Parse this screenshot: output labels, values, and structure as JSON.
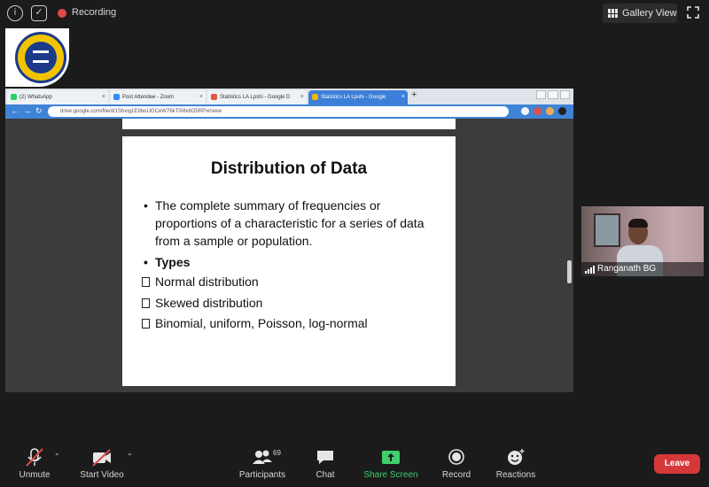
{
  "topbar": {
    "recording_label": "Recording",
    "gallery_view_label": "Gallery View",
    "icons": [
      "info-icon",
      "shield-icon",
      "recording-dot-icon",
      "gallery-grid-icon",
      "fullscreen-icon"
    ]
  },
  "browser": {
    "tabs": [
      {
        "label": "(2) WhatsApp",
        "color": "#25d366"
      },
      {
        "label": "Post Attendee - Zoom",
        "color": "#2d8cff"
      },
      {
        "label": "Statistics LA Lpshi - Google D",
        "color": "#e0573c"
      },
      {
        "label": "Statistics LA Lpshi - Google",
        "color": "#f4b400"
      }
    ],
    "url": "drive.google.com/file/d/1Sbvig1E9boIJGCeW76kTl08x8O5RPxi/view"
  },
  "slide": {
    "title": "Distribution of Data",
    "bullet1": "The complete summary of frequencies or proportions of a characteristic for a series of data from a sample or population.",
    "bullet2": "Types",
    "items": [
      "Normal distribution",
      "Skewed distribution",
      "Binomial, uniform, Poisson, log-normal"
    ]
  },
  "participant": {
    "name": "Ranganath BG"
  },
  "toolbar": {
    "unmute_label": "Unmute",
    "start_video_label": "Start Video",
    "participants_label": "Participants",
    "participants_count": "69",
    "chat_label": "Chat",
    "share_screen_label": "Share Screen",
    "record_label": "Record",
    "reactions_label": "Reactions",
    "leave_label": "Leave"
  },
  "colors": {
    "background": "#1b1b1b",
    "share_green": "#3fcf6c",
    "leave_red": "#d6383a",
    "browser_blue": "#3e84d6"
  }
}
